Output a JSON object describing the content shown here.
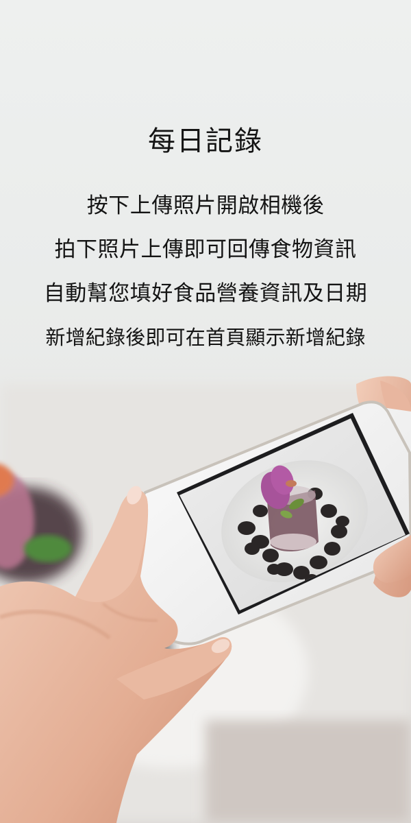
{
  "title": "每日記錄",
  "description_lines": [
    "按下上傳照片開啟相機後",
    "拍下照片上傳即可回傳食物資訊",
    "自動幫您填好食品營養資訊及日期",
    "新增紀錄後即可在首頁顯示新增紀錄"
  ],
  "colors": {
    "text": "#141414",
    "background": "#eaeceb"
  }
}
